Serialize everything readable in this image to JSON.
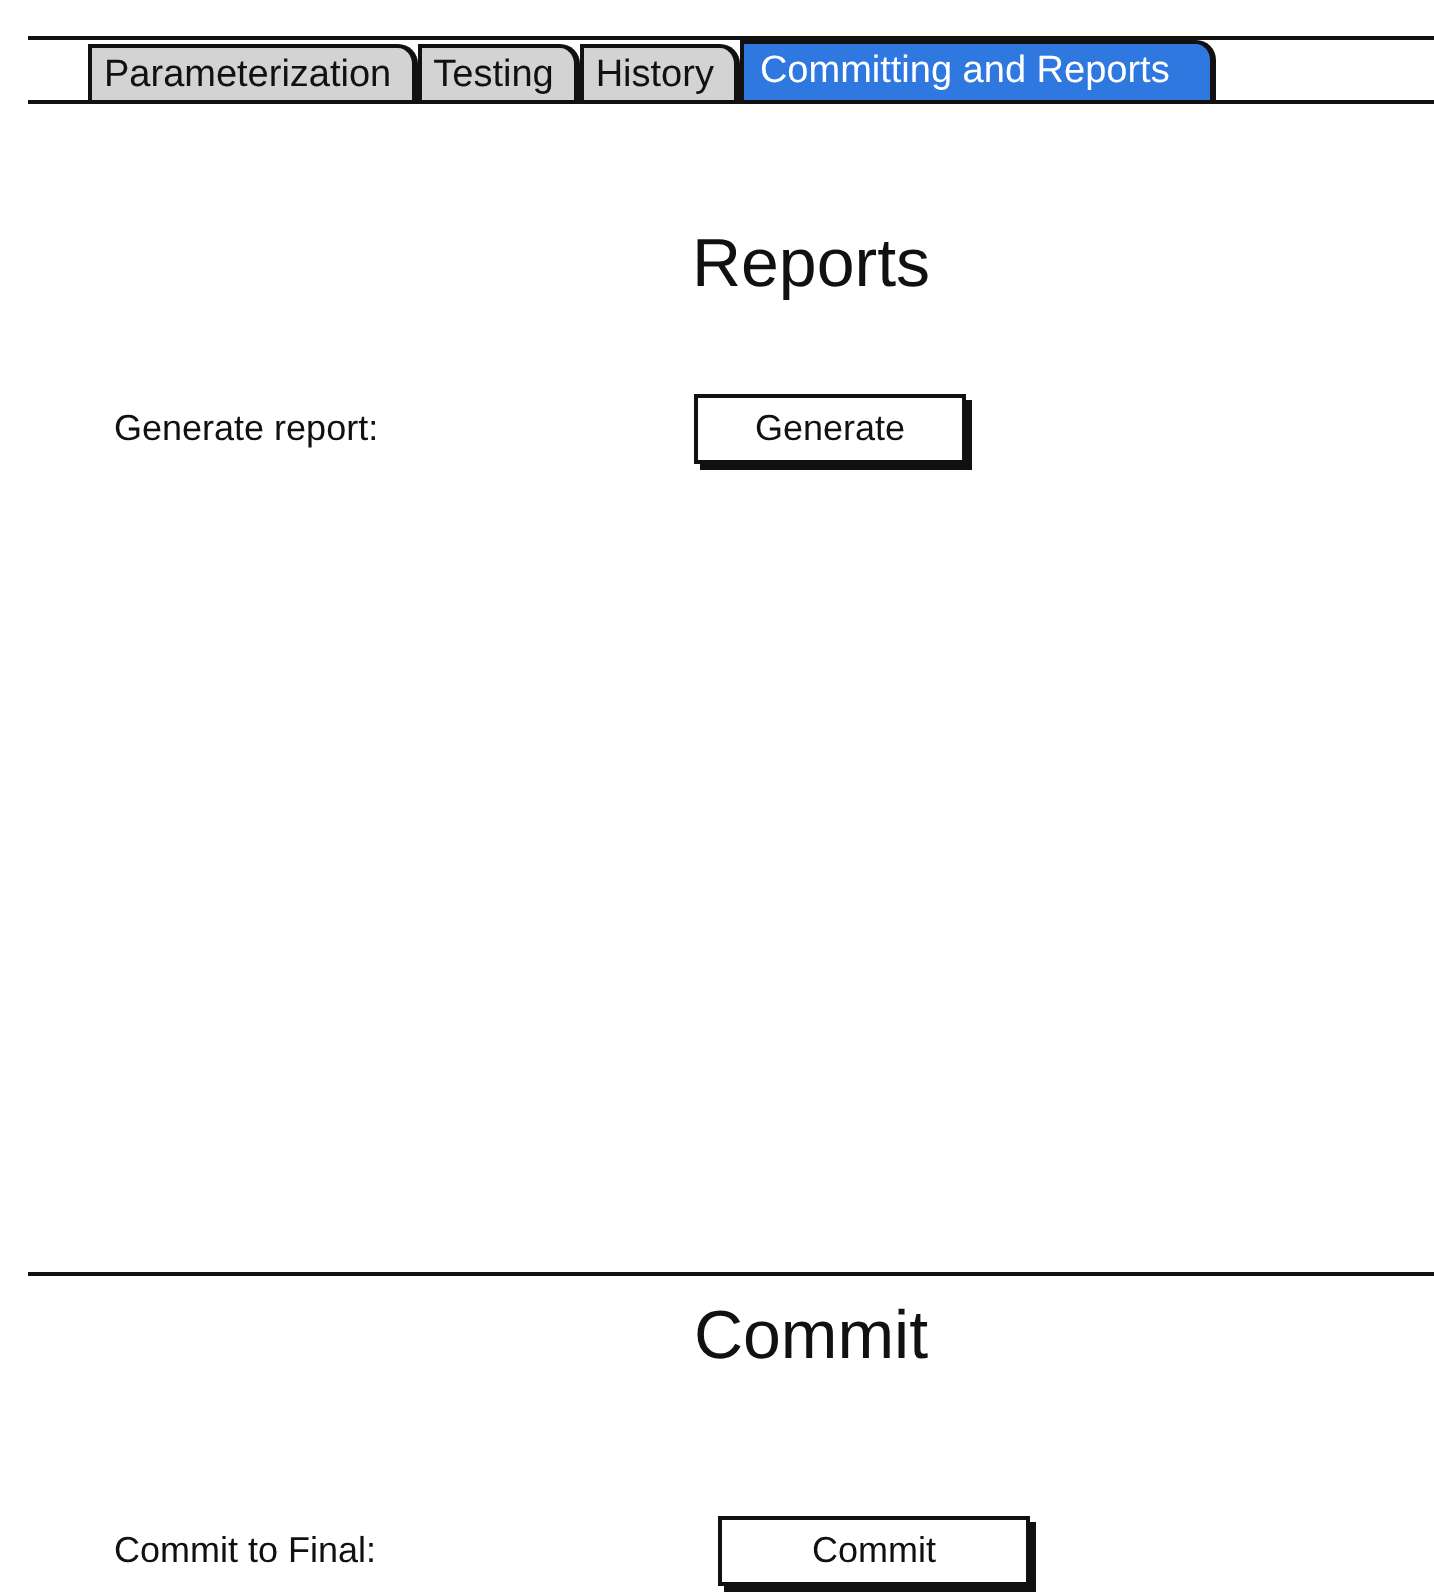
{
  "tabs": [
    {
      "label": "Parameterization",
      "selected": false
    },
    {
      "label": "Testing",
      "selected": false
    },
    {
      "label": "History",
      "selected": false
    },
    {
      "label": "Committing and Reports",
      "selected": true
    }
  ],
  "sections": [
    {
      "title": "Reports",
      "rows": [
        {
          "label": "Generate report:",
          "button": "Generate"
        }
      ]
    },
    {
      "title": "Commit",
      "rows": [
        {
          "label": "Commit to Final:",
          "button": "Commit"
        }
      ]
    }
  ]
}
